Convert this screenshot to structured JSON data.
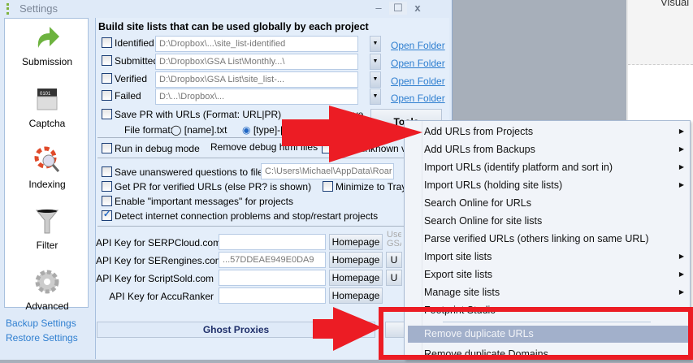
{
  "window": {
    "title": "Settings",
    "minimize": "–",
    "maximize": "☐",
    "close": "x"
  },
  "sidebar": {
    "items": [
      {
        "label": "Submission",
        "icon": "arrow-icon"
      },
      {
        "label": "Captcha",
        "icon": "captcha-icon"
      },
      {
        "label": "Indexing",
        "icon": "lifebuoy-icon"
      },
      {
        "label": "Filter",
        "icon": "funnel-icon"
      },
      {
        "label": "Advanced",
        "icon": "gear-icon"
      }
    ],
    "backup": "Backup Settings",
    "restore": "Restore Settings"
  },
  "main": {
    "heading": "Build site lists that can be used globally by each project",
    "lists": [
      {
        "label": "Identified",
        "path": "D:\\Dropbox\\...\\site_list-identified"
      },
      {
        "label": "Submitted",
        "path": "D:\\Dropbox\\GSA List\\Monthly...\\"
      },
      {
        "label": "Verified",
        "path": "D:\\Dropbox\\GSA List\\site_list-..."
      },
      {
        "label": "Failed",
        "path": "D:\\...\\Dropbox\\..."
      }
    ],
    "open_folder": "Open Folder",
    "save_pr": "Save PR with URLs (Format: URL|PR)",
    "remove_partial": "move",
    "file_format": "File format:",
    "format1": "[name].txt",
    "format2": "[type]-[na",
    "tools": "Tools",
    "debug": "Run in debug mode",
    "remove_debug": "Remove debug html files",
    "save_unknown": "Save unknown va",
    "save_unanswered": "Save unanswered questions to file",
    "unanswered_path": "C:\\Users\\Michael\\AppData\\Roar",
    "get_pr": "Get PR for verified URLs (else PR? is shown)",
    "minimize_tray": "Minimize to Tray",
    "important": "Enable \"important messages\" for projects",
    "detect": "Detect internet connection problems and stop/restart projects",
    "api": [
      {
        "label": "API Key for SERPCloud.com",
        "value": ""
      },
      {
        "label": "API Key for SERengines.com",
        "value": "...57DDEAE949E0DA9"
      },
      {
        "label": "API Key for ScriptSold.com",
        "value": ""
      },
      {
        "label": "API Key for AccuRanker",
        "value": ""
      }
    ],
    "homepage": "Homepage",
    "use_gsa": "Use GSA",
    "u": "U",
    "ghost": "Ghost Proxies"
  },
  "menu": {
    "items": [
      {
        "label": "Add URLs from Projects",
        "sub": true
      },
      {
        "label": "Add URLs from Backups",
        "sub": true
      },
      {
        "label": "Import URLs (identify platform and sort in)",
        "sub": true
      },
      {
        "label": "Import URLs (holding site lists)",
        "sub": true
      },
      {
        "label": "Search Online for URLs",
        "sub": false
      },
      {
        "label": "Search Online for site lists",
        "sub": false
      },
      {
        "label": "Parse verified URLs (others linking on same URL)",
        "sub": false
      },
      {
        "label": "Import site lists",
        "sub": true
      },
      {
        "label": "Export site lists",
        "sub": true
      },
      {
        "label": "Manage site lists",
        "sub": true
      },
      {
        "label": "Footprint Studio",
        "sub": false
      },
      {
        "label": "Remove duplicate URLs",
        "sub": false,
        "highlighted": true
      },
      {
        "label": "Remove duplicate Domains",
        "sub": false
      }
    ]
  },
  "right_panel": {
    "text": "Visual"
  },
  "colors": {
    "annotation_red": "#ec1c24",
    "highlight": "#a2b0cb"
  }
}
